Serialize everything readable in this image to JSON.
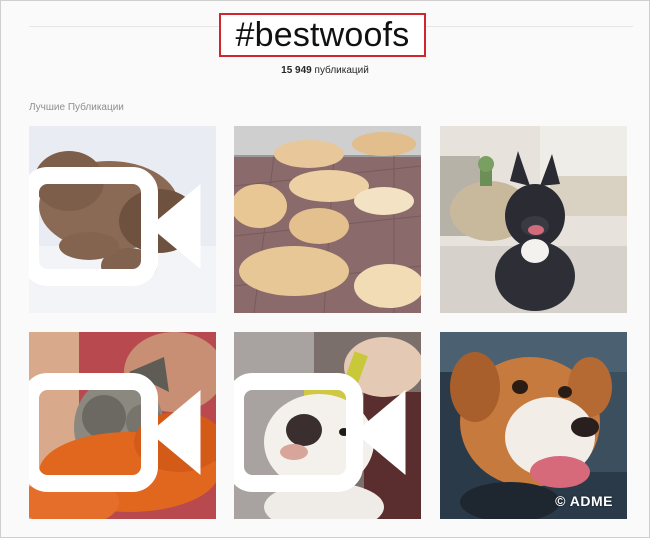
{
  "hashtag": {
    "title": "#bestwoofs"
  },
  "stats": {
    "count": "15 949",
    "label": "публикаций"
  },
  "section": {
    "label": "Лучшие Публикации"
  },
  "posts": [
    {
      "name": "post-brown-poodle-snow",
      "video": true
    },
    {
      "name": "post-golden-puppies",
      "video": false
    },
    {
      "name": "post-french-bulldog",
      "video": false
    },
    {
      "name": "post-schnauzer-towel",
      "video": true
    },
    {
      "name": "post-bull-terrier-brush",
      "video": true
    },
    {
      "name": "post-boxer-mix-car",
      "video": false
    }
  ],
  "watermark": "© ADME",
  "colors": {
    "highlight_border": "#d0272e",
    "muted_text": "#8e8e8e"
  }
}
